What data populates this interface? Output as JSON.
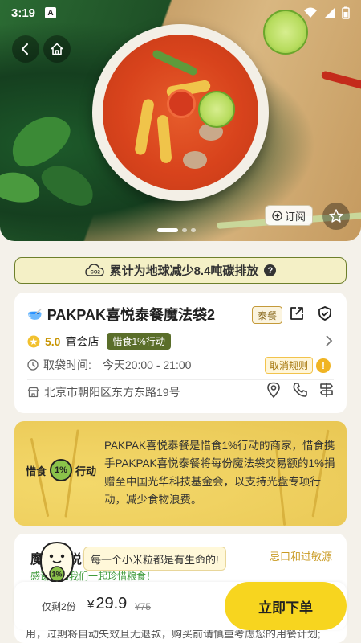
{
  "status_bar": {
    "time": "3:19",
    "notification_badge": "A"
  },
  "hero": {
    "subscribe_label": "订阅",
    "carousel_count": 3,
    "carousel_active_index": 0
  },
  "carbon_banner": {
    "text": "累计为地球减少8.4吨碳排放",
    "help_symbol": "?"
  },
  "store": {
    "emoji": "🥣",
    "name": "PAKPAK喜悦泰餐魔法袋2",
    "category_tag": "泰餐",
    "rating": "5.0",
    "store_type": "官会店",
    "campaign_badge": "惜食1%行动",
    "pickup_label": "取袋时间:",
    "pickup_time": "今天20:00 - 21:00",
    "cancel_rules": "取消规则",
    "cancel_mark": "!",
    "address": "北京市朝阳区东方东路19号"
  },
  "promo": {
    "logo_left": "惜食",
    "logo_pct": "1%",
    "logo_right": "行动",
    "text": "PAKPAK喜悦泰餐是惜食1%行动的商家，惜食携手PAKPAK喜悦泰餐将每份魔法袋交易额的1%捐赠至中国光华科技基金会，以支持光盘专项行动，减少食物浪费。"
  },
  "rules": {
    "heading": "魔法袋说明",
    "allergy_link": "忌口和过敏源",
    "green_note": "感谢您和我们一起珍惜粮食！",
    "body_fragment": "用，过期将自动失效且无退款，购买前请慎重考虑您的用餐计划;"
  },
  "mascot": {
    "tooltip": "每一个小米粒都是有生命的!",
    "badge": "1%"
  },
  "bottom_bar": {
    "remaining": "仅剩2份",
    "currency": "¥",
    "price": "29.9",
    "original_price": "¥75",
    "buy_label": "立即下单"
  },
  "colors": {
    "accent_yellow": "#f7d51f",
    "brand_green": "#5a6e2a",
    "carbon_border": "#6d7f2b",
    "rating_gold": "#c79400"
  },
  "icons": [
    "back-icon",
    "home-icon",
    "star-icon",
    "plus-circle-icon",
    "co2-icon",
    "share-icon",
    "shield-check-icon",
    "chevron-right-icon",
    "clock-icon",
    "store-icon",
    "location-pin-icon",
    "phone-icon",
    "signpost-icon"
  ]
}
